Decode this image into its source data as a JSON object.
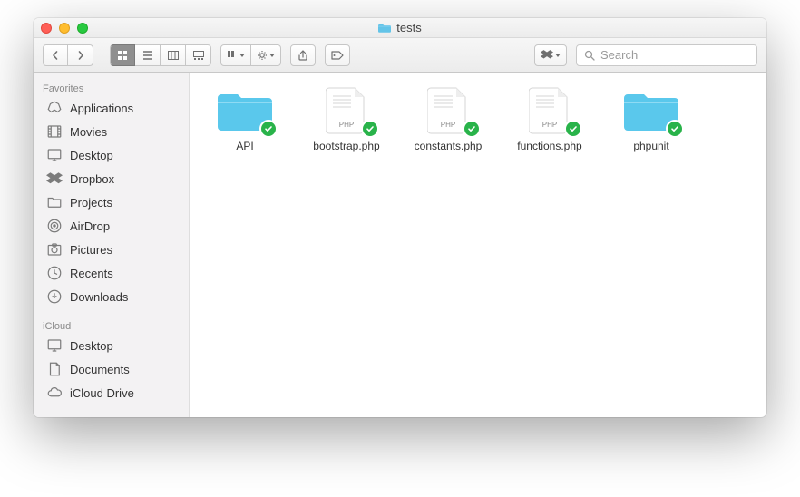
{
  "window": {
    "title": "tests"
  },
  "search": {
    "placeholder": "Search"
  },
  "sidebar": {
    "sections": [
      {
        "title": "Favorites",
        "items": [
          {
            "label": "Applications",
            "icon": "applications-icon"
          },
          {
            "label": "Movies",
            "icon": "movies-icon"
          },
          {
            "label": "Desktop",
            "icon": "desktop-icon"
          },
          {
            "label": "Dropbox",
            "icon": "dropbox-icon"
          },
          {
            "label": "Projects",
            "icon": "folder-icon"
          },
          {
            "label": "AirDrop",
            "icon": "airdrop-icon"
          },
          {
            "label": "Pictures",
            "icon": "pictures-icon"
          },
          {
            "label": "Recents",
            "icon": "recents-icon"
          },
          {
            "label": "Downloads",
            "icon": "downloads-icon"
          }
        ]
      },
      {
        "title": "iCloud",
        "items": [
          {
            "label": "Desktop",
            "icon": "desktop-icon"
          },
          {
            "label": "Documents",
            "icon": "documents-icon"
          },
          {
            "label": "iCloud Drive",
            "icon": "icloud-icon"
          }
        ]
      }
    ]
  },
  "files": [
    {
      "name": "API",
      "type": "folder"
    },
    {
      "name": "bootstrap.php",
      "type": "php"
    },
    {
      "name": "constants.php",
      "type": "php"
    },
    {
      "name": "functions.php",
      "type": "php"
    },
    {
      "name": "phpunit",
      "type": "folder"
    }
  ]
}
